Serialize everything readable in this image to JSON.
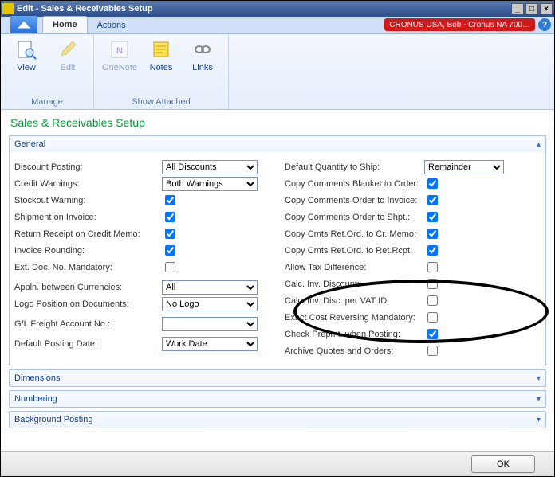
{
  "title": "Edit - Sales & Receivables Setup",
  "tabs": {
    "home": "Home",
    "actions": "Actions"
  },
  "status_pill": "CRONUS USA, Bob - Cronus NA 700…",
  "ribbon": {
    "view": "View",
    "edit": "Edit",
    "onenote": "OneNote",
    "notes": "Notes",
    "links": "Links",
    "group_manage": "Manage",
    "group_show": "Show Attached"
  },
  "page_title": "Sales & Receivables Setup",
  "sections": {
    "general": "General",
    "dimensions": "Dimensions",
    "numbering": "Numbering",
    "background": "Background Posting"
  },
  "left": {
    "discount_posting": {
      "label": "Discount Posting:",
      "value": "All Discounts"
    },
    "credit_warnings": {
      "label": "Credit Warnings:",
      "value": "Both Warnings"
    },
    "stockout_warning": {
      "label": "Stockout Warning:",
      "checked": true
    },
    "shipment_on_invoice": {
      "label": "Shipment on Invoice:",
      "checked": true
    },
    "return_receipt": {
      "label": "Return Receipt on Credit Memo:",
      "checked": true
    },
    "invoice_rounding": {
      "label": "Invoice Rounding:",
      "checked": true
    },
    "ext_doc_mand": {
      "label": "Ext. Doc. No. Mandatory:",
      "checked": false
    },
    "appln_currencies": {
      "label": "Appln. between Currencies:",
      "value": "All"
    },
    "logo_position": {
      "label": "Logo Position on Documents:",
      "value": "No Logo"
    },
    "gl_freight": {
      "label": "G/L Freight Account No.:",
      "value": ""
    },
    "default_posting_date": {
      "label": "Default Posting Date:",
      "value": "Work Date"
    }
  },
  "right": {
    "default_qty_ship": {
      "label": "Default Quantity to Ship:",
      "value": "Remainder"
    },
    "copy_blanket_order": {
      "label": "Copy Comments Blanket to Order:",
      "checked": true
    },
    "copy_order_invoice": {
      "label": "Copy Comments Order to Invoice:",
      "checked": true
    },
    "copy_order_shpt": {
      "label": "Copy Comments Order to Shpt.:",
      "checked": true
    },
    "copy_ret_crmemo": {
      "label": "Copy Cmts Ret.Ord. to Cr. Memo:",
      "checked": true
    },
    "copy_ret_retrcpt": {
      "label": "Copy Cmts Ret.Ord. to Ret.Rcpt:",
      "checked": true
    },
    "allow_tax_diff": {
      "label": "Allow Tax Difference:",
      "checked": false
    },
    "calc_inv_discount": {
      "label": "Calc. Inv. Discount:",
      "checked": false
    },
    "calc_inv_disc_vat": {
      "label": "Calc. Inv. Disc. per VAT ID:",
      "checked": false
    },
    "exact_cost_rev": {
      "label": "Exact Cost Reversing Mandatory:",
      "checked": false
    },
    "check_prepmt": {
      "label": "Check Prepmt. when Posting:",
      "checked": true
    },
    "archive_quotes": {
      "label": "Archive Quotes and Orders:",
      "checked": false
    }
  },
  "ok": "OK"
}
